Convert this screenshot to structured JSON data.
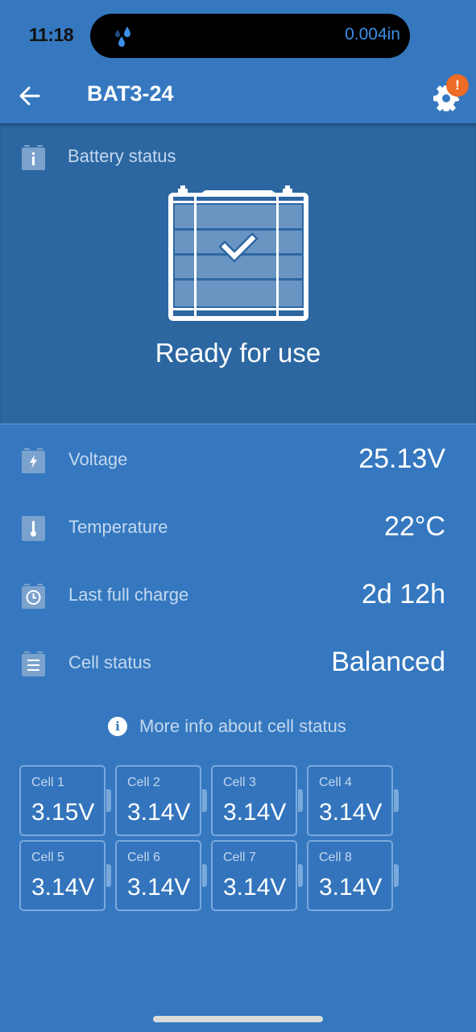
{
  "status_bar": {
    "time": "11:18",
    "island_icon": "rain-drops-icon",
    "island_text": "0.004in"
  },
  "app_bar": {
    "back_icon": "arrow-left-icon",
    "title": "BAT3-24",
    "settings_icon": "gear-icon",
    "settings_badge": "!"
  },
  "battery_status": {
    "section_icon": "info-battery-icon",
    "label": "Battery status",
    "graphic_icon": "battery-check-icon",
    "status_text": "Ready for use"
  },
  "metrics": [
    {
      "icon": "lightning-battery-icon",
      "label": "Voltage",
      "value": "25.13V"
    },
    {
      "icon": "thermometer-icon",
      "label": "Temperature",
      "value": "22°C"
    },
    {
      "icon": "clock-icon",
      "label": "Last full charge",
      "value": "2d 12h"
    },
    {
      "icon": "list-icon",
      "label": "Cell status",
      "value": "Balanced"
    }
  ],
  "more_info": {
    "icon": "info-icon",
    "icon_glyph": "i",
    "label": "More info about cell status"
  },
  "cells": [
    {
      "name": "Cell 1",
      "voltage": "3.15V"
    },
    {
      "name": "Cell 2",
      "voltage": "3.14V"
    },
    {
      "name": "Cell 3",
      "voltage": "3.14V"
    },
    {
      "name": "Cell 4",
      "voltage": "3.14V"
    },
    {
      "name": "Cell 5",
      "voltage": "3.14V"
    },
    {
      "name": "Cell 6",
      "voltage": "3.14V"
    },
    {
      "name": "Cell 7",
      "voltage": "3.14V"
    },
    {
      "name": "Cell 8",
      "voltage": "3.14V"
    }
  ],
  "colors": {
    "background": "#3578c0",
    "panel": "#2c67a2",
    "badge": "#ec6b25",
    "muted_text": "#c4d8ee",
    "island_text": "#3d8ee8"
  }
}
